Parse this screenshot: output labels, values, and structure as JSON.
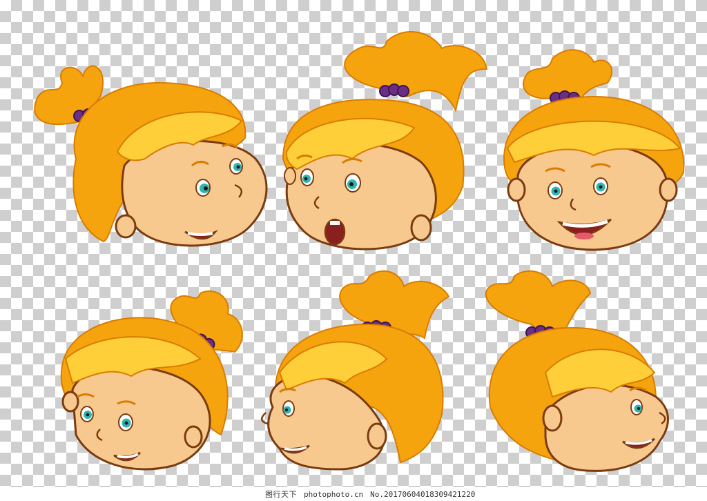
{
  "image": {
    "subject": "six cartoon heads of a child with orange hair",
    "background": "transparent checkerboard"
  },
  "colors": {
    "hair": "#f5a40e",
    "hair_light": "#ffcf3a",
    "hair_dark": "#d97c00",
    "skin": "#f8c98e",
    "skin_shadow": "#e8a86a",
    "outline": "#7a3b10",
    "bead": "#6b2d86",
    "eye": "#2fb5b0",
    "mouth": "#8a1f1f"
  },
  "footer": {
    "site_name": "图行天下",
    "domain": "photophoto.cn",
    "code": "No.20170604018309421220"
  }
}
